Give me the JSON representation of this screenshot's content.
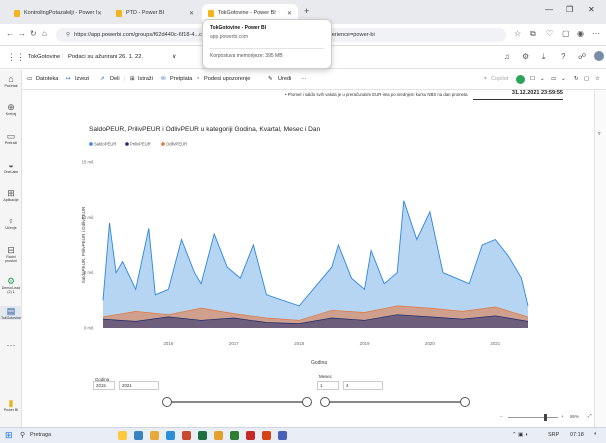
{
  "browser": {
    "tabs": [
      {
        "label": "KontrolingPotazalelji - Power I"
      },
      {
        "label": "PTD - Power BI"
      },
      {
        "label": "TokGotovine - Power BI"
      }
    ],
    "new_tab": "+",
    "url": "https://app.powerbi.com/groups/f62d440c-6f18-4...c-8338-4404-bcd6-285740c63111/ReportSection?experience=power-bi",
    "popup": {
      "title": "TokGotovine - Power BI",
      "domain": "app.powerbi.com",
      "memory": "Korpostuva memorijeze: 395 MB"
    }
  },
  "appbar": {
    "report_name": "TokGotovine",
    "data_updated": "Podaci su ažurirani 26. 1. 22.",
    "chevron": "∨"
  },
  "ribbon": {
    "items": [
      "Datoteka",
      "Izvezi",
      "Deli",
      "Istraži",
      "Pretplata",
      "Podesi upozorenje",
      "Uredi"
    ],
    "more": "···",
    "copilot": "Copilot"
  },
  "rail": {
    "items": [
      {
        "icon": "home-icon",
        "label": "Početak"
      },
      {
        "icon": "plus-icon",
        "label": "Kreiraj"
      },
      {
        "icon": "folder-icon",
        "label": "Pretraži"
      },
      {
        "icon": "onelake-icon",
        "label": "OneLake"
      },
      {
        "icon": "apps-icon",
        "label": "Aplikacije"
      },
      {
        "icon": "learn-icon",
        "label": "Učenje"
      },
      {
        "icon": "workspaces-icon",
        "label": "Radni prostori"
      },
      {
        "icon": "workspace-icon",
        "label": "Demo/Lead (2) 1"
      },
      {
        "icon": "report-icon",
        "label": "TokGotovine"
      },
      {
        "icon": "more-icon",
        "label": "···"
      },
      {
        "icon": "powerbi-icon",
        "label": "Power BI"
      }
    ]
  },
  "report": {
    "note": "• Promet i saldo svih valuta je u preračunatim EUR-ima po srednjem kursu NBS na dan prometa",
    "date_box": "31.12.2021 23:59:55",
    "chart_title": "SaldoPEUR, PrilivPEUR i OdlivPEUR u kategoriji Godina, Kvartal, Mesec i Dan",
    "slicers": {
      "year_label": "Godina",
      "year_from": "2015",
      "year_to": "2021",
      "month_label": "Mesec",
      "month_from": "1",
      "month_to": "4"
    }
  },
  "chart_data": {
    "type": "area",
    "title": "SaldoPEUR, PrilivPEUR i OdlivPEUR u kategoriji Godina, Kvartal, Mesec i Dan",
    "ylabel": "SaldoPEUR, PrilivPEUR i OdlivPEUR",
    "xlabel": "Godina",
    "y_ticks": [
      "15 mil.",
      "10 mil.",
      "5 mil.",
      "0 mil."
    ],
    "ylim": [
      0,
      15
    ],
    "x_ticks": [
      "2016",
      "2017",
      "2018",
      "2019",
      "2020",
      "2021"
    ],
    "legend": [
      "SaldoPEUR",
      "PrilivPEUR",
      "OdlivPEUR"
    ],
    "legend_placement": "top-left",
    "colors": {
      "SaldoPEUR": "#2e86de",
      "PrilivPEUR": "#1b2a6b",
      "OdlivPEUR": "#e5743a"
    },
    "series": [
      {
        "name": "SaldoPEUR",
        "x": [
          2015.5,
          2015.6,
          2015.7,
          2015.8,
          2016.0,
          2016.2,
          2016.3,
          2016.5,
          2016.7,
          2016.9,
          2017.0,
          2017.2,
          2017.4,
          2017.6,
          2017.8,
          2018.0,
          2018.5,
          2019.0,
          2019.1,
          2019.3,
          2019.5,
          2019.6,
          2019.8,
          2020.0,
          2020.1,
          2020.3,
          2020.5,
          2020.7,
          2020.9,
          2021.1,
          2021.3,
          2021.5,
          2021.7,
          2021.9,
          2022.0
        ],
        "values": [
          2.5,
          9.5,
          5.0,
          6.0,
          3.5,
          9.0,
          3.0,
          3.5,
          8.0,
          5.0,
          4.0,
          8.5,
          5.5,
          4.5,
          7.5,
          3.0,
          2.0,
          5.5,
          7.5,
          4.5,
          3.5,
          7.0,
          4.0,
          5.0,
          11.5,
          8.0,
          10.5,
          5.0,
          4.5,
          4.0,
          7.5,
          8.0,
          6.5,
          4.5,
          2.0
        ]
      },
      {
        "name": "PrilivPEUR",
        "x": [
          2015.5,
          2016.0,
          2016.5,
          2017.0,
          2017.5,
          2018.0,
          2018.5,
          2019.0,
          2019.5,
          2020.0,
          2020.5,
          2021.0,
          2021.5,
          2022.0
        ],
        "values": [
          0.8,
          0.6,
          1.0,
          0.7,
          0.9,
          0.5,
          0.4,
          0.9,
          0.7,
          1.2,
          1.0,
          0.8,
          1.1,
          0.6
        ]
      },
      {
        "name": "OdlivPEUR",
        "x": [
          2015.5,
          2016.0,
          2016.5,
          2017.0,
          2017.5,
          2018.0,
          2018.5,
          2019.0,
          2019.5,
          2020.0,
          2020.5,
          2021.0,
          2021.5,
          2022.0
        ],
        "values": [
          1.0,
          1.5,
          1.2,
          1.8,
          1.3,
          0.9,
          0.7,
          1.6,
          1.4,
          2.0,
          1.8,
          1.5,
          1.9,
          1.0
        ]
      }
    ]
  },
  "zoom": {
    "value": "86%"
  },
  "taskbar": {
    "search": "Pretraga",
    "lang": "SRP",
    "time": "07:18"
  }
}
